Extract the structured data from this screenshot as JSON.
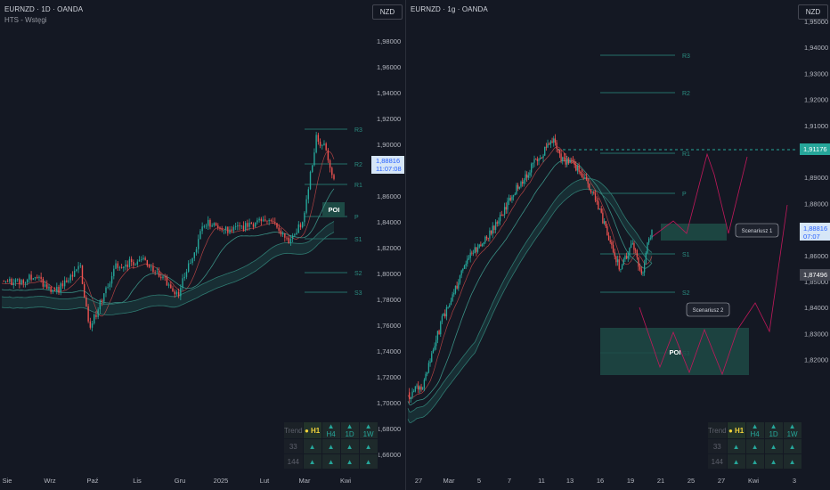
{
  "left_chart": {
    "symbol": "EURNZD · 1D · OANDA",
    "indicator": "HTS - Wstęgi",
    "currency": "NZD",
    "price_ticks": [
      "1,98000",
      "1,96000",
      "1,94000",
      "1,92000",
      "1,90000",
      "1,88000",
      "1,86000",
      "1,84000",
      "1,82000",
      "1,80000",
      "1,78000",
      "1,76000",
      "1,74000",
      "1,72000",
      "1,70000",
      "1,68000",
      "1,66000"
    ],
    "time_ticks": [
      "Sie",
      "Wrz",
      "Paź",
      "Lis",
      "Gru",
      "2025",
      "Lut",
      "Mar",
      "Kwi"
    ],
    "current_price": "1,88816",
    "countdown": "11:07:08",
    "pivot_labels": [
      "R3",
      "R2",
      "R1",
      "P",
      "S1",
      "S2",
      "S3"
    ],
    "poi_label": "POI",
    "trend_table": {
      "header": [
        "Trend",
        "● H1",
        "▲ H4",
        "▲ 1D",
        "▲ 1W"
      ],
      "rows": [
        [
          "33",
          "▲",
          "▲",
          "▲",
          "▲"
        ],
        [
          "144",
          "▲",
          "▲",
          "▲",
          "▲"
        ]
      ]
    }
  },
  "right_chart": {
    "symbol": "EURNZD · 1g · OANDA",
    "currency": "NZD",
    "price_ticks": [
      "1,95000",
      "1,94000",
      "1,93000",
      "1,92000",
      "1,91000",
      "1,90000",
      "1,89000",
      "1,88000",
      "1,87000",
      "1,86000",
      "1,85000",
      "1,84000",
      "1,83000",
      "1,82000"
    ],
    "time_ticks": [
      "27",
      "Mar",
      "5",
      "7",
      "11",
      "13",
      "16",
      "19",
      "21",
      "25",
      "27",
      "Kwi",
      "3"
    ],
    "current_price": "1,88816",
    "countdown": "07:07",
    "high_marker": "1,91176",
    "low_marker": "1,87496",
    "pivot_labels": [
      "R3",
      "R2",
      "R1",
      "P",
      "S1",
      "S2",
      "S3"
    ],
    "scenario_1": "Scenariusz 1",
    "scenario_2": "Scenariusz 2",
    "poi_label": "POI",
    "trend_table": {
      "header": [
        "Trend",
        "● H1",
        "▲ H4",
        "▲ 1D",
        "▲ 1W"
      ],
      "rows": [
        [
          "33",
          "▲",
          "▲",
          "▲",
          "▲"
        ],
        [
          "144",
          "▲",
          "▲",
          "▲",
          "▲"
        ]
      ]
    }
  },
  "colors": {
    "up": "#26a69a",
    "down": "#ef5350",
    "band": "#1f5a55",
    "pivot": "#2a8c80",
    "background": "#131722"
  }
}
